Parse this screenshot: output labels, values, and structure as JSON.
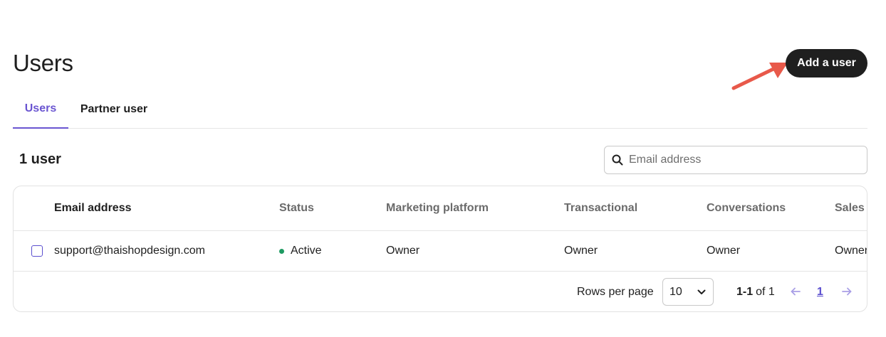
{
  "page": {
    "title": "Users"
  },
  "actions": {
    "add_user_label": "Add a user"
  },
  "tabs": [
    {
      "label": "Users",
      "active": true
    },
    {
      "label": "Partner user",
      "active": false
    }
  ],
  "summary": {
    "count_label": "1 user"
  },
  "search": {
    "placeholder": "Email address",
    "value": ""
  },
  "table": {
    "columns": [
      "Email address",
      "Status",
      "Marketing platform",
      "Transactional",
      "Conversations",
      "Sales"
    ],
    "rows": [
      {
        "email": "support@thaishopdesign.com",
        "status": "Active",
        "marketing_platform": "Owner",
        "transactional": "Owner",
        "conversations": "Owner",
        "sales": "Owner"
      }
    ]
  },
  "pagination": {
    "rows_per_page_label": "Rows per page",
    "rows_per_page_value": "10",
    "range_label": "1-1",
    "of_label": "of 1",
    "current_page": "1"
  },
  "colors": {
    "accent": "#6a55d1",
    "primary_button": "#1f1f1f",
    "status_active": "#1e9a62",
    "annotation_arrow": "#e8594a"
  },
  "icons": {
    "search": "search-icon",
    "dropdown": "chevron-down-icon",
    "prev": "arrow-left-icon",
    "next": "arrow-right-icon",
    "annotation": "annotation-arrow-icon"
  }
}
